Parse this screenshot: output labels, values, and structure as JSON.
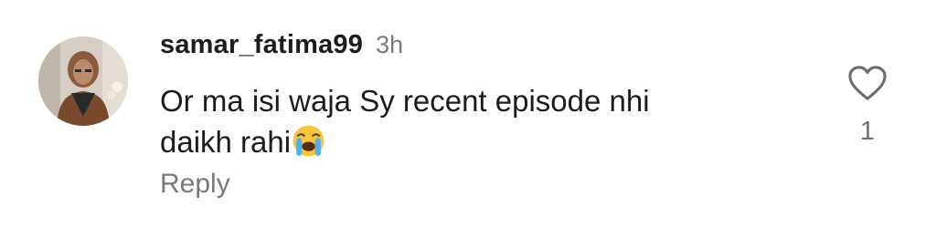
{
  "comment": {
    "username": "samar_fatima99",
    "timestamp": "3h",
    "text": "Or ma isi waja Sy recent episode nhi\ndaikh rahi",
    "emoji": "loudly-crying-face-emoji",
    "reply_label": "Reply",
    "like_icon": "heart-outline-icon",
    "like_count": "1"
  }
}
